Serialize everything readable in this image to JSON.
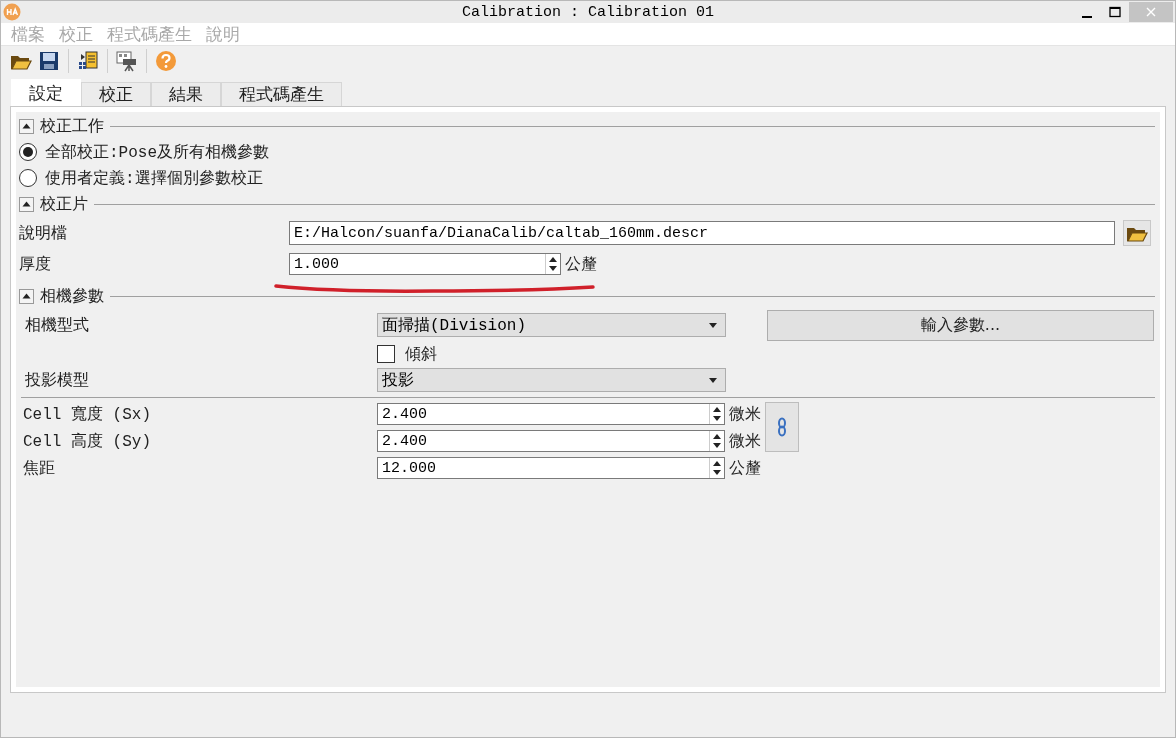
{
  "window": {
    "title": "Calibration : Calibration 01"
  },
  "menu": [
    {
      "label": "檔案",
      "disabled": true
    },
    {
      "label": "校正",
      "disabled": true
    },
    {
      "label": "程式碼產生",
      "disabled": true
    },
    {
      "label": "說明",
      "disabled": true
    }
  ],
  "tabs": [
    {
      "label": "設定",
      "selected": true
    },
    {
      "label": "校正",
      "selected": false
    },
    {
      "label": "結果",
      "selected": false
    },
    {
      "label": "程式碼產生",
      "selected": false
    }
  ],
  "calibration_task": {
    "title": "校正工作",
    "expanded": true,
    "options": [
      {
        "label": "全部校正:Pose及所有相機參數",
        "selected": true
      },
      {
        "label": "使用者定義:選擇個別參數校正",
        "selected": false
      }
    ]
  },
  "calibration_plate": {
    "title": "校正片",
    "expanded": true,
    "description_file": {
      "label": "說明檔",
      "value": "E:/Halcon/suanfa/DianaCalib/caltab_160mm.descr"
    },
    "thickness": {
      "label": "厚度",
      "value": "1.000",
      "unit": "公釐"
    }
  },
  "camera_parameters": {
    "title": "相機參數",
    "expanded": true,
    "camera_type": {
      "label": "相機型式",
      "value": "面掃描(Division)"
    },
    "import_button": "輸入參數...",
    "tilt": {
      "label": "傾斜",
      "checked": false
    },
    "projection_model": {
      "label": "投影模型",
      "value": "投影"
    },
    "cells": [
      {
        "label": "Cell 寬度 (Sx)",
        "value": "2.400",
        "unit": "微米"
      },
      {
        "label": "Cell 高度 (Sy)",
        "value": "2.400",
        "unit": "微米"
      },
      {
        "label": "焦距",
        "value": "12.000",
        "unit": "公釐"
      }
    ]
  }
}
